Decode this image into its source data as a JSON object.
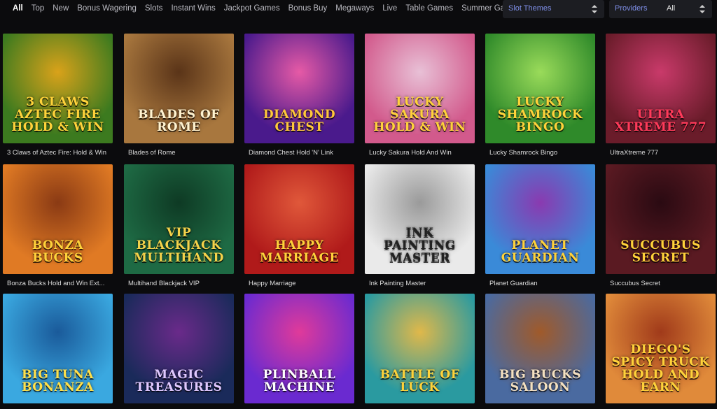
{
  "categories": [
    "All",
    "Top",
    "New",
    "Bonus Wagering",
    "Slots",
    "Instant Wins",
    "Jackpot Games",
    "Bonus Buy",
    "Megaways",
    "Live",
    "Table Games",
    "Summer Games"
  ],
  "slot_themes": {
    "label": "Slot Themes"
  },
  "providers": {
    "label": "Providers",
    "value": "All"
  },
  "games": [
    {
      "title": "3 Claws of Aztec Fire: Hold & Win",
      "logo": "3 Claws Aztec Fire Hold & Win",
      "bg1": "#3c7a1f",
      "bg2": "#d9a21a",
      "logoColor": "#ffd23a"
    },
    {
      "title": "Blades of Rome",
      "logo": "Blades of Rome",
      "bg1": "#a8773e",
      "bg2": "#5a3418",
      "logoColor": "#fff3d0"
    },
    {
      "title": "Diamond Chest Hold 'N' Link",
      "logo": "Diamond Chest",
      "bg1": "#4a1a8c",
      "bg2": "#e65aa6",
      "logoColor": "#ffc83a"
    },
    {
      "title": "Lucky Sakura Hold And Win",
      "logo": "Lucky Sakura Hold & Win",
      "bg1": "#d25a8c",
      "bg2": "#e8c0d6",
      "logoColor": "#ffd23a"
    },
    {
      "title": "Lucky Shamrock Bingo",
      "logo": "Lucky Shamrock Bingo",
      "bg1": "#2f8a2a",
      "bg2": "#9adb5a",
      "logoColor": "#ffd23a"
    },
    {
      "title": "UltraXtreme 777",
      "logo": "Ultra Xtreme 777",
      "bg1": "#6a1c2a",
      "bg2": "#c93a6a",
      "logoColor": "#ff3a5a"
    },
    {
      "title": "Bonza Bucks Hold and Win Ext...",
      "logo": "Bonza Bucks",
      "bg1": "#e07a24",
      "bg2": "#8a3a14",
      "logoColor": "#ffd23a"
    },
    {
      "title": "Multihand Blackjack VIP",
      "logo": "VIP Blackjack Multihand",
      "bg1": "#1e6a44",
      "bg2": "#0e3a24",
      "logoColor": "#f4d24a"
    },
    {
      "title": "Happy Marriage",
      "logo": "Happy Marriage",
      "bg1": "#b01a1a",
      "bg2": "#e0583a",
      "logoColor": "#ffd23a"
    },
    {
      "title": "Ink Painting Master",
      "logo": "Ink Painting Master",
      "bg1": "#eaeaea",
      "bg2": "#9a9a9a",
      "logoColor": "#222222"
    },
    {
      "title": "Planet Guardian",
      "logo": "Planet Guardian",
      "bg1": "#3a8ad8",
      "bg2": "#8a3ab0",
      "logoColor": "#ffd23a"
    },
    {
      "title": "Succubus Secret",
      "logo": "Succubus Secret",
      "bg1": "#5a1a22",
      "bg2": "#2a0a12",
      "logoColor": "#ffd23a"
    },
    {
      "title": "",
      "logo": "Big Tuna Bonanza",
      "bg1": "#3aa8e0",
      "bg2": "#1a5a9a",
      "logoColor": "#ffe04a"
    },
    {
      "title": "",
      "logo": "Magic Treasures",
      "bg1": "#1a2a5a",
      "bg2": "#6a2a8a",
      "logoColor": "#e0c8ff"
    },
    {
      "title": "",
      "logo": "Plinball Machine",
      "bg1": "#6a2ad0",
      "bg2": "#e03a9a",
      "logoColor": "#ffffff"
    },
    {
      "title": "",
      "logo": "Battle of Luck",
      "bg1": "#2a9aa0",
      "bg2": "#e0b84a",
      "logoColor": "#ffd23a"
    },
    {
      "title": "",
      "logo": "Big Bucks Saloon",
      "bg1": "#4a6aa0",
      "bg2": "#a05a2a",
      "logoColor": "#f4e0c0"
    },
    {
      "title": "",
      "logo": "Diego's Spicy Truck Hold and Earn",
      "bg1": "#e08a3a",
      "bg2": "#a03a1a",
      "logoColor": "#ffd23a"
    }
  ]
}
